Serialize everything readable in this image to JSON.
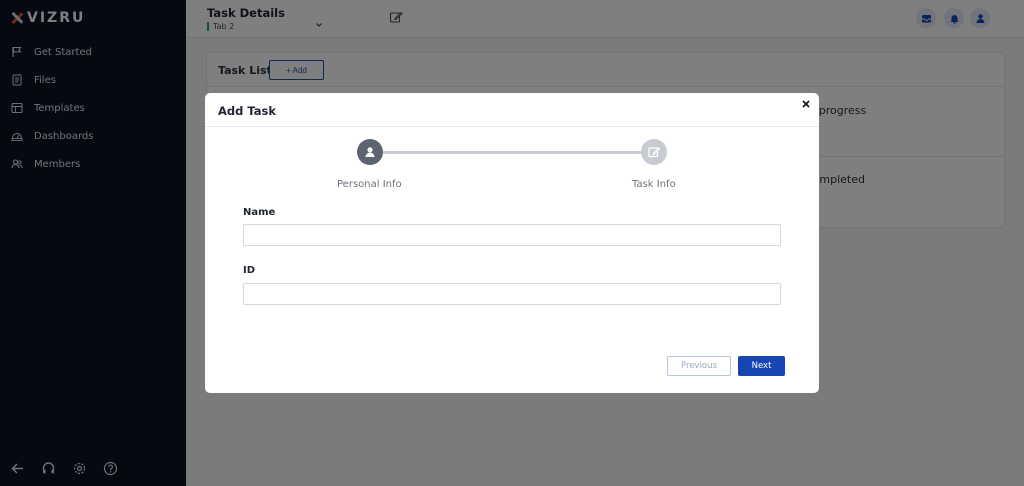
{
  "brand": {
    "name": "VIZRU",
    "accent": "#e2572c"
  },
  "sidebar": {
    "items": [
      {
        "label": "Get Started",
        "icon": "flag-icon"
      },
      {
        "label": "Files",
        "icon": "file-icon"
      },
      {
        "label": "Templates",
        "icon": "template-icon"
      },
      {
        "label": "Dashboards",
        "icon": "dashboard-icon"
      },
      {
        "label": "Members",
        "icon": "members-icon"
      }
    ],
    "bottom_icons": [
      "back-arrow-icon",
      "headset-icon",
      "gear-icon",
      "help-icon"
    ]
  },
  "header": {
    "title": "Task Details",
    "tab_selected": "Tab 2",
    "icons": [
      "edit-icon",
      "inbox-icon",
      "bell-icon",
      "user-icon"
    ]
  },
  "content": {
    "task_list_title": "Task List",
    "add_label": "+ Add",
    "status_1": "In progress",
    "status_2": "Completed"
  },
  "modal": {
    "title": "Add Task",
    "steps": [
      {
        "label": "Personal Info",
        "icon": "user-icon",
        "active": true
      },
      {
        "label": "Task Info",
        "icon": "edit-icon",
        "active": false
      }
    ],
    "fields": [
      {
        "label": "Name",
        "value": "",
        "placeholder": ""
      },
      {
        "label": "ID",
        "value": "",
        "placeholder": ""
      }
    ],
    "previous_label": "Previous",
    "next_label": "Next"
  },
  "colors": {
    "sidebar_bg": "#0d1324",
    "primary": "#1746b3",
    "step_active": "#5c6470",
    "step_inactive": "#c8cbd1"
  }
}
